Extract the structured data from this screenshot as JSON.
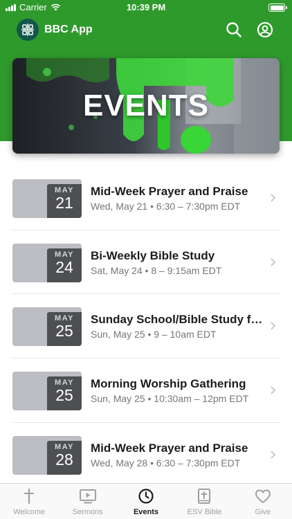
{
  "status_bar": {
    "carrier": "Carrier",
    "time": "10:39 PM"
  },
  "header": {
    "app_name": "BBC App"
  },
  "banner": {
    "title": "EVENTS"
  },
  "events": [
    {
      "month": "MAY",
      "day": "21",
      "title": "Mid-Week Prayer and Praise",
      "subtitle": "Wed, May 21 • 6:30 – 7:30pm EDT"
    },
    {
      "month": "MAY",
      "day": "24",
      "title": "Bi-Weekly Bible Study",
      "subtitle": "Sat, May 24 • 8 – 9:15am EDT"
    },
    {
      "month": "MAY",
      "day": "25",
      "title": "Sunday School/Bible Study for...",
      "subtitle": "Sun, May 25 • 9 – 10am EDT"
    },
    {
      "month": "MAY",
      "day": "25",
      "title": "Morning Worship Gathering",
      "subtitle": "Sun, May 25 • 10:30am – 12pm EDT"
    },
    {
      "month": "MAY",
      "day": "28",
      "title": "Mid-Week Prayer and Praise",
      "subtitle": "Wed, May 28 • 6:30 – 7:30pm EDT"
    }
  ],
  "tabs": [
    {
      "label": "Welcome",
      "icon": "cross-icon",
      "active": false
    },
    {
      "label": "Sermons",
      "icon": "video-icon",
      "active": false
    },
    {
      "label": "Events",
      "icon": "clock-icon",
      "active": true
    },
    {
      "label": "ESV Bible",
      "icon": "bible-icon",
      "active": false
    },
    {
      "label": "Give",
      "icon": "heart-icon",
      "active": false
    }
  ],
  "colors": {
    "header_green": "#2f9a2c",
    "date_box": "#4e4f52",
    "date_tile": "#bcbdc2",
    "logo_bg": "#13584a"
  }
}
